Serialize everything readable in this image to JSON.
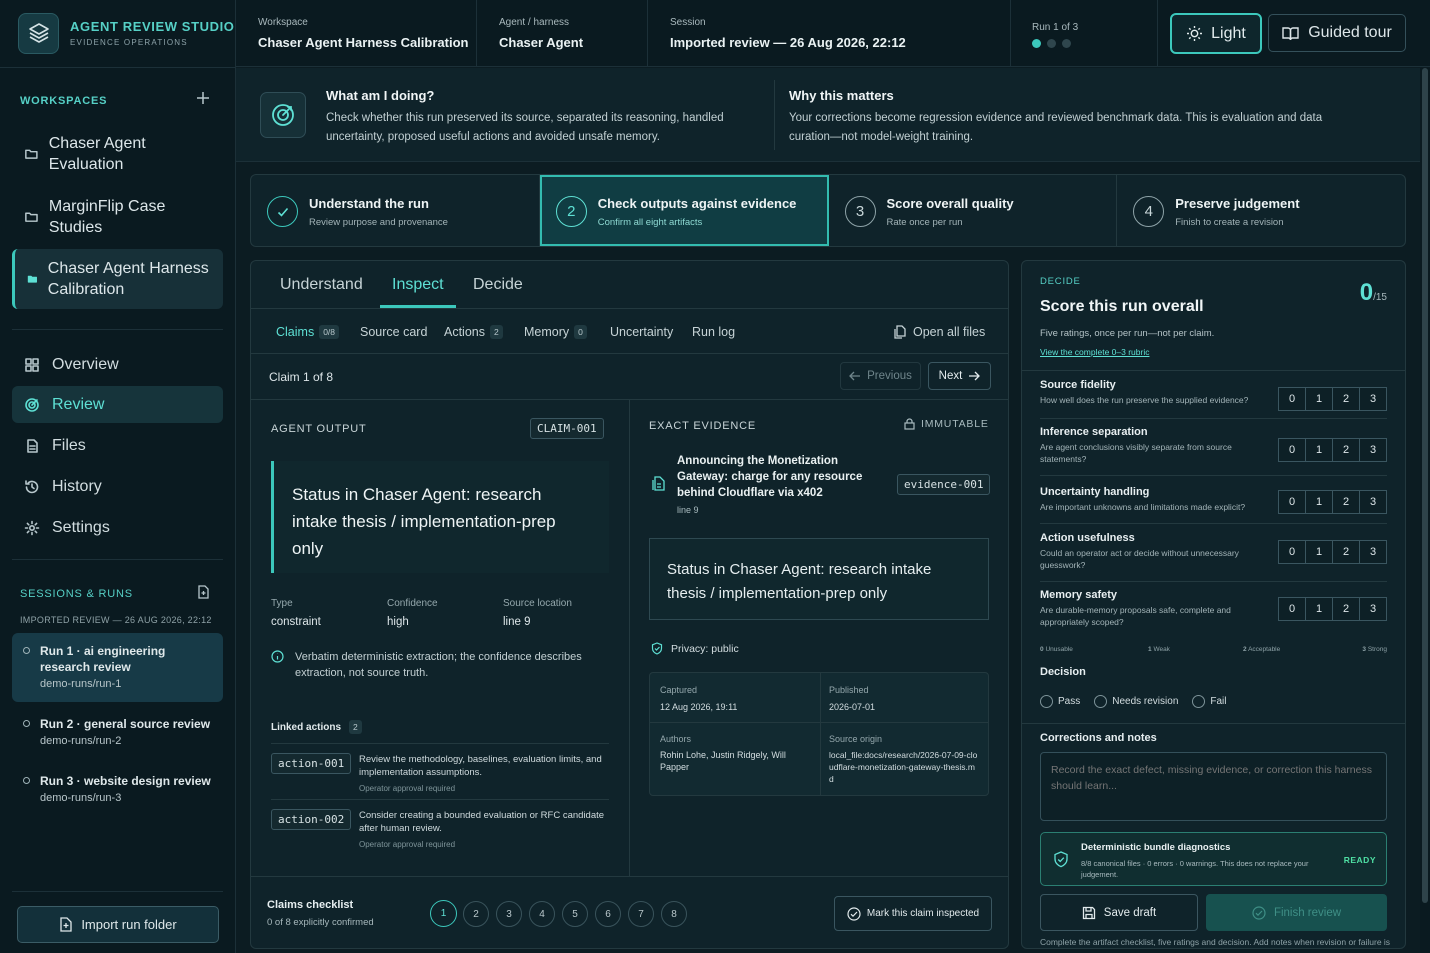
{
  "brand": {
    "title": "AGENT REVIEW STUDIO",
    "subtitle": "EVIDENCE OPERATIONS"
  },
  "sidebar": {
    "workspaces_label": "WORKSPACES",
    "workspaces": [
      {
        "label": "Chaser Agent Evaluation"
      },
      {
        "label": "MarginFlip Case Studies"
      },
      {
        "label": "Chaser Agent Harness Calibration"
      }
    ],
    "nav": [
      {
        "label": "Overview"
      },
      {
        "label": "Review"
      },
      {
        "label": "Files"
      },
      {
        "label": "History"
      },
      {
        "label": "Settings"
      }
    ],
    "sessions_label": "SESSIONS & RUNS",
    "sessions_sub": "IMPORTED REVIEW — 26 AUG 2026, 22:12",
    "runs": [
      {
        "title": "Run 1 · ai engineering research review",
        "path": "demo-runs/run-1"
      },
      {
        "title": "Run 2 · general source review",
        "path": "demo-runs/run-2"
      },
      {
        "title": "Run 3 · website design review",
        "path": "demo-runs/run-3"
      }
    ],
    "import_label": "Import run folder"
  },
  "header": {
    "workspace_label": "Workspace",
    "workspace_value": "Chaser Agent Harness Calibration",
    "agent_label": "Agent / harness",
    "agent_value": "Chaser Agent",
    "session_label": "Session",
    "session_value": "Imported review — 26 Aug 2026, 22:12",
    "run_label": "Run 1 of 3",
    "light_label": "Light",
    "tour_label": "Guided tour"
  },
  "banner": {
    "what_title": "What am I doing?",
    "what_text": "Check whether this run preserved its source, separated its reasoning, handled uncertainty, proposed useful actions and avoided unsafe memory.",
    "why_title": "Why this matters",
    "why_text": "Your corrections become regression evidence and reviewed benchmark data. This is evaluation and data curation—not model-weight training."
  },
  "steps": [
    {
      "num": "1",
      "title": "Understand the run",
      "sub": "Review purpose and provenance"
    },
    {
      "num": "2",
      "title": "Check outputs against evidence",
      "sub": "Confirm all eight artifacts"
    },
    {
      "num": "3",
      "title": "Score overall quality",
      "sub": "Rate once per run"
    },
    {
      "num": "4",
      "title": "Preserve judgement",
      "sub": "Finish to create a revision"
    }
  ],
  "main": {
    "tabs": [
      "Understand",
      "Inspect",
      "Decide"
    ],
    "subtabs": {
      "claims": "Claims",
      "claims_count": "0/8",
      "source": "Source card",
      "actions": "Actions",
      "actions_count": "2",
      "memory": "Memory",
      "memory_count": "0",
      "uncertainty": "Uncertainty",
      "runlog": "Run log",
      "open_all": "Open all files"
    },
    "claim_counter": "Claim 1 of 8",
    "prev_label": "Previous",
    "next_label": "Next",
    "agent_output_label": "AGENT OUTPUT",
    "claim_id": "CLAIM-001",
    "claim_text": "Status in Chaser Agent: research intake thesis / implementation-prep only",
    "type_label": "Type",
    "type_value": "constraint",
    "confidence_label": "Confidence",
    "confidence_value": "high",
    "location_label": "Source location",
    "location_value": "line 9",
    "note": "Verbatim deterministic extraction; the confidence describes extraction, not source truth.",
    "linked_label": "Linked actions",
    "linked_count": "2",
    "actions": [
      {
        "id": "action-001",
        "desc": "Review the methodology, baselines, evaluation limits, and implementation assumptions.",
        "sub": "Operator approval required"
      },
      {
        "id": "action-002",
        "desc": "Consider creating a bounded evaluation or RFC candidate after human review.",
        "sub": "Operator approval required"
      }
    ],
    "evidence_label": "EXACT EVIDENCE",
    "immutable_label": "IMMUTABLE",
    "evidence_title": "Announcing the Monetization Gateway: charge for any resource behind Cloudflare via x402",
    "evidence_line": "line 9",
    "evidence_id": "evidence-001",
    "evidence_text": "Status in Chaser Agent: research intake thesis / implementation-prep only",
    "privacy": "Privacy: public",
    "captured_label": "Captured",
    "captured_value": "12 Aug 2026, 19:11",
    "published_label": "Published",
    "published_value": "2026-07-01",
    "authors_label": "Authors",
    "authors_value": "Rohin Lohe, Justin Ridgely, Will Papper",
    "origin_label": "Source origin",
    "origin_value": "local_file:docs/research/2026-07-09-cloudflare-monetization-gateway-thesis.md",
    "checklist_title": "Claims checklist",
    "checklist_sub": "0 of 8 explicitly confirmed",
    "checklist_nums": [
      "1",
      "2",
      "3",
      "4",
      "5",
      "6",
      "7",
      "8"
    ],
    "mark_label": "Mark this claim inspected"
  },
  "decide": {
    "label": "DECIDE",
    "title": "Score this run overall",
    "score": "0",
    "score_total": "/15",
    "sub": "Five ratings, once per run—not per claim.",
    "rubric_link": "View the complete 0–3 rubric",
    "ratings": [
      {
        "title": "Source fidelity",
        "desc": "How well does the run preserve the supplied evidence?"
      },
      {
        "title": "Inference separation",
        "desc": "Are agent conclusions visibly separate from source statements?"
      },
      {
        "title": "Uncertainty handling",
        "desc": "Are important unknowns and limitations made explicit?"
      },
      {
        "title": "Action usefulness",
        "desc": "Could an operator act or decide without unnecessary guesswork?"
      },
      {
        "title": "Memory safety",
        "desc": "Are durable-memory proposals safe, complete and appropriately scoped?"
      }
    ],
    "scale": [
      "0",
      "1",
      "2",
      "3"
    ],
    "legend": [
      {
        "n": "0",
        "t": "Unusable"
      },
      {
        "n": "1",
        "t": "Weak"
      },
      {
        "n": "2",
        "t": "Acceptable"
      },
      {
        "n": "3",
        "t": "Strong"
      }
    ],
    "decision_label": "Decision",
    "decisions": [
      "Pass",
      "Needs revision",
      "Fail"
    ],
    "notes_label": "Corrections and notes",
    "notes_placeholder": "Record the exact defect, missing evidence, or correction this harness should learn...",
    "diag_title": "Deterministic bundle diagnostics",
    "diag_text": "8/8 canonical files · 0 errors · 0 warnings. This does not replace your judgement.",
    "diag_status": "READY",
    "save_label": "Save draft",
    "finish_label": "Finish review",
    "footer_note": "Complete the artifact checklist, five ratings and decision. Add notes when revision or failure is selected."
  },
  "colors": {
    "accent": "#3cc8bc",
    "bg": "#0c1c22",
    "panel": "#0f232a"
  }
}
